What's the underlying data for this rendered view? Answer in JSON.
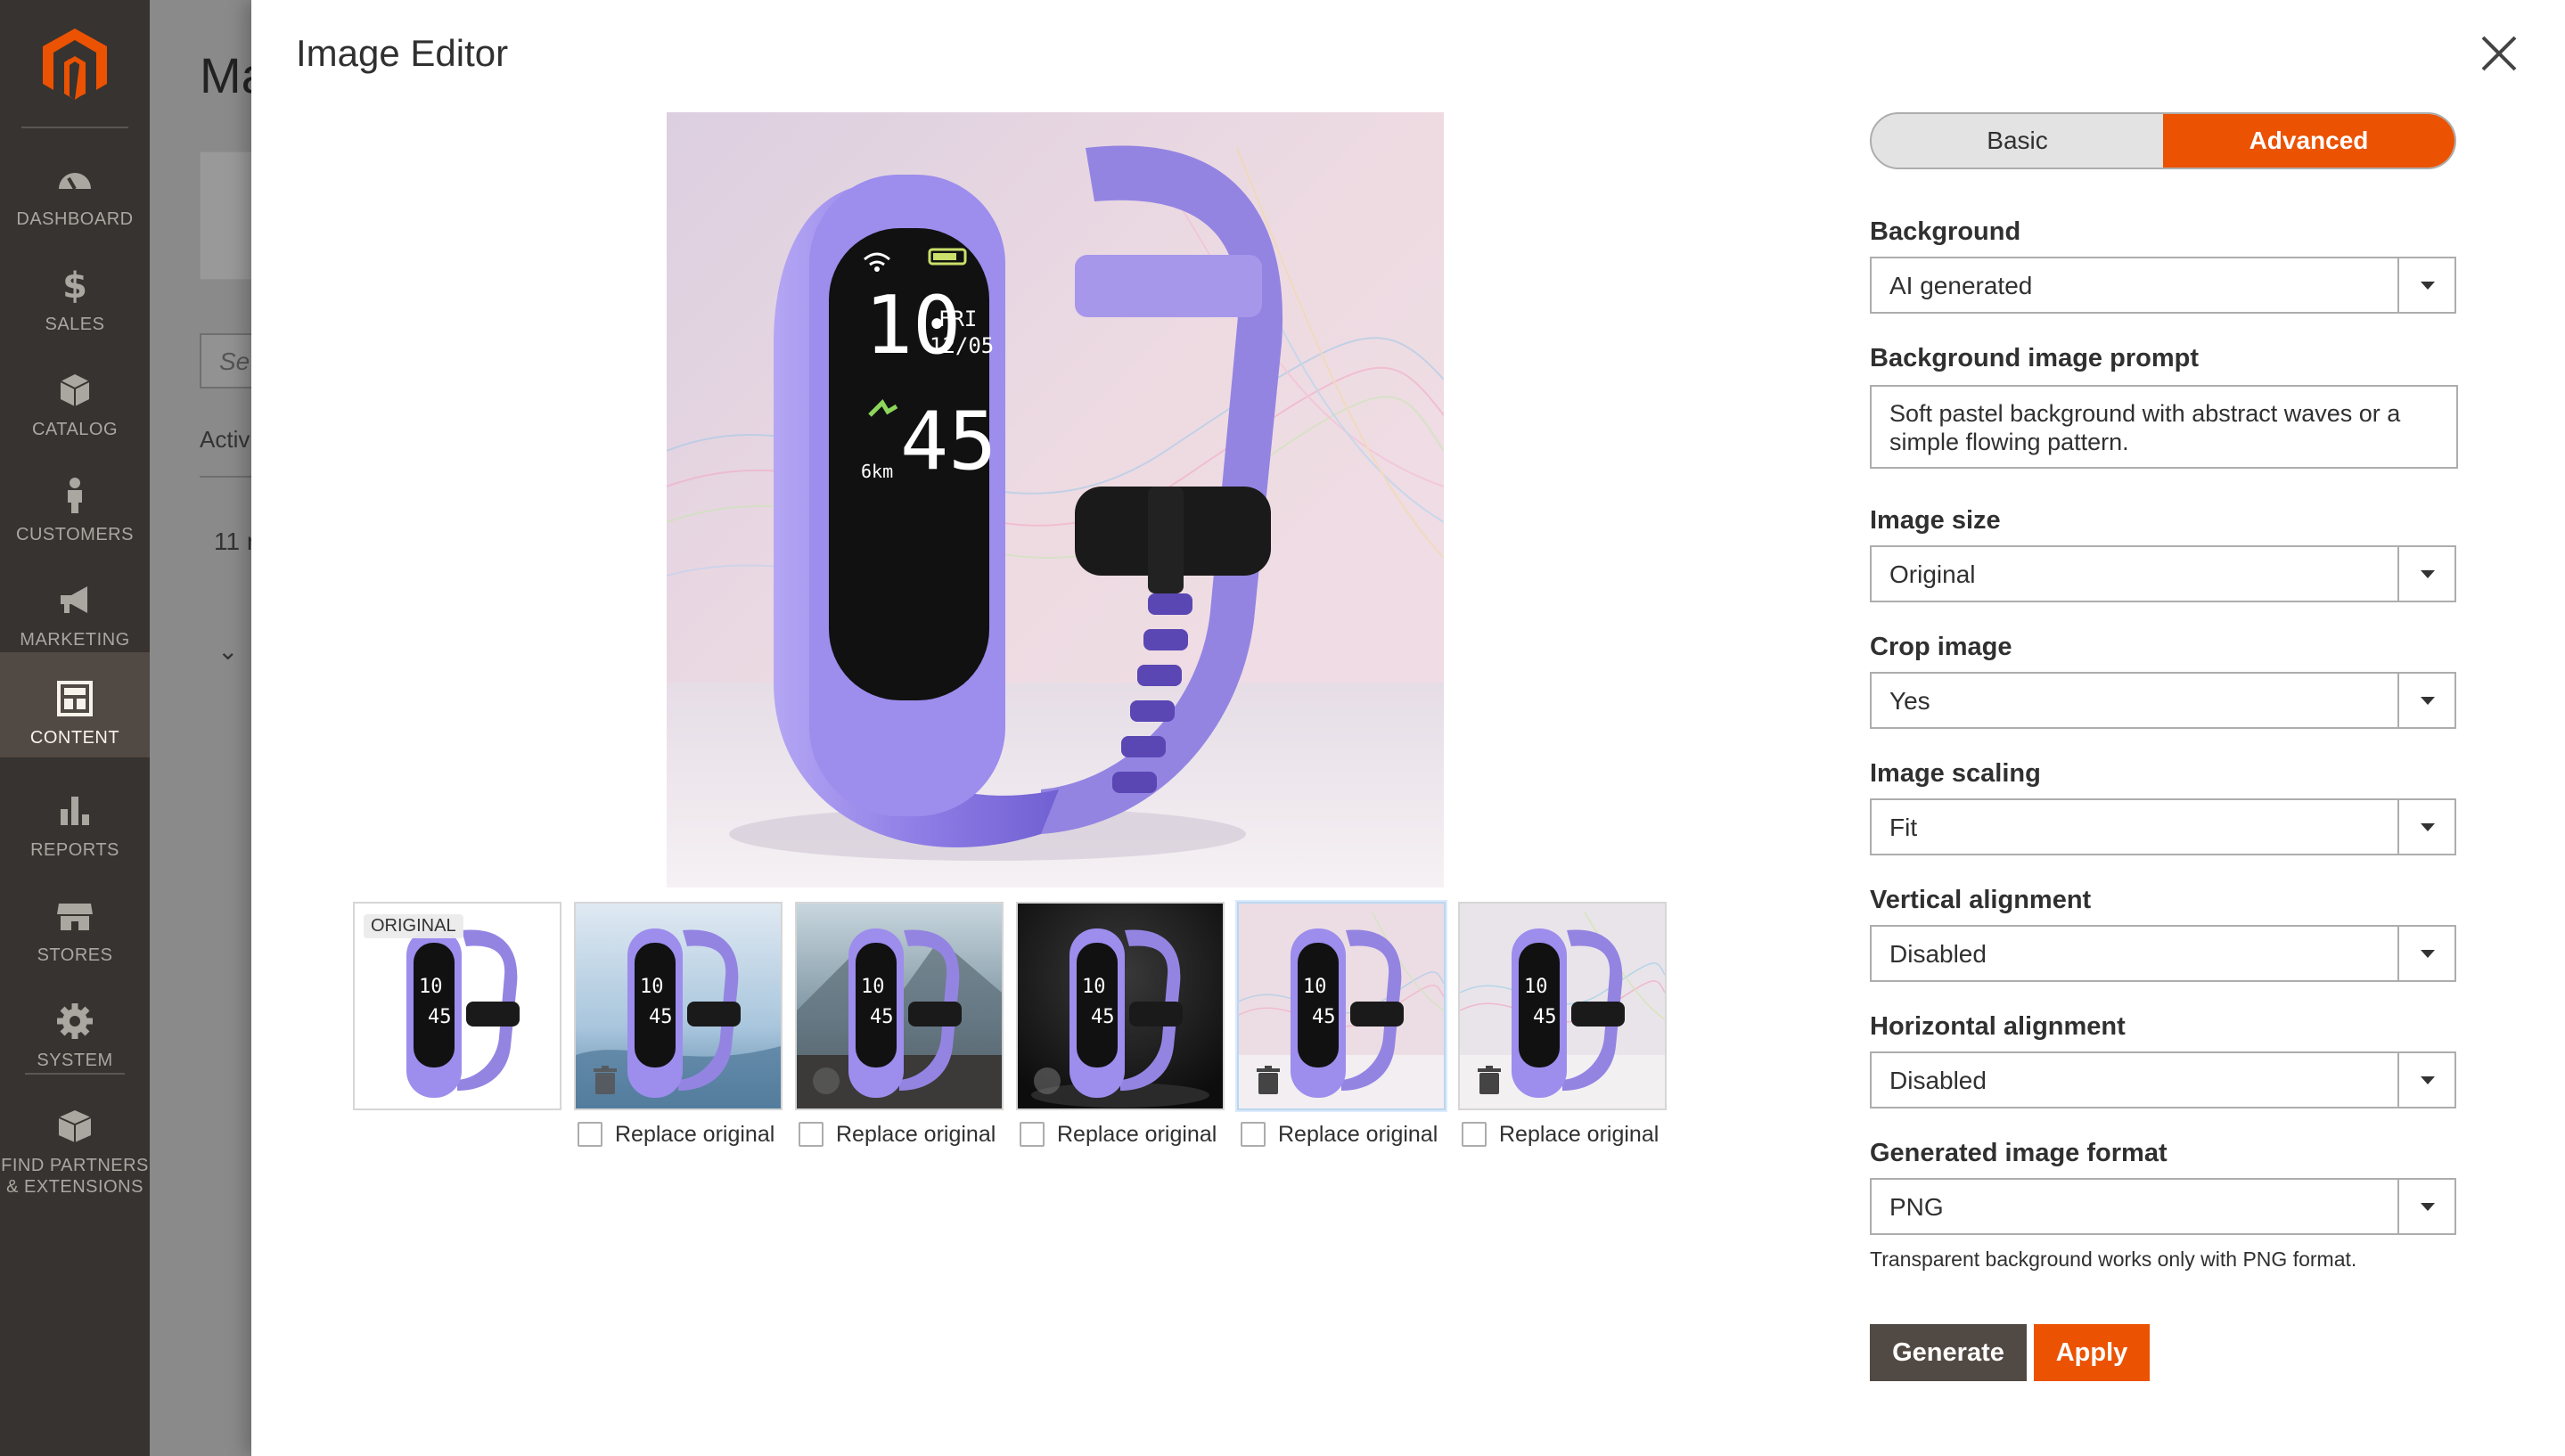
{
  "sidebar": {
    "logo": "magento-logo",
    "items": [
      {
        "label": "DASHBOARD",
        "icon": "dashboard-icon"
      },
      {
        "label": "SALES",
        "icon": "dollar-icon"
      },
      {
        "label": "CATALOG",
        "icon": "box-icon"
      },
      {
        "label": "CUSTOMERS",
        "icon": "person-icon"
      },
      {
        "label": "MARKETING",
        "icon": "megaphone-icon"
      },
      {
        "label": "CONTENT",
        "icon": "content-icon",
        "active": true
      },
      {
        "label": "REPORTS",
        "icon": "bar-chart-icon"
      },
      {
        "label": "STORES",
        "icon": "store-icon"
      },
      {
        "label": "SYSTEM",
        "icon": "gear-icon"
      },
      {
        "label": "FIND PARTNERS",
        "label2": "& EXTENSIONS",
        "icon": "partners-icon"
      }
    ]
  },
  "background_page": {
    "title": "Ma",
    "search_placeholder": "Se",
    "active_text": "Activ",
    "count_text": "11 r"
  },
  "modal": {
    "title": "Image Editor",
    "thumbnails": [
      {
        "badge": "ORIGINAL",
        "bg": "white"
      },
      {
        "replace_label": "Replace original",
        "bg": "water"
      },
      {
        "replace_label": "Replace original",
        "bg": "rocks"
      },
      {
        "replace_label": "Replace original",
        "bg": "dark"
      },
      {
        "replace_label": "Replace original",
        "bg": "pastel",
        "selected": true
      },
      {
        "replace_label": "Replace original",
        "bg": "pastel-light"
      }
    ],
    "mode_toggle": {
      "basic": "Basic",
      "advanced": "Advanced",
      "active": "advanced"
    },
    "fields": {
      "background": {
        "label": "Background",
        "value": "AI generated"
      },
      "background_prompt": {
        "label": "Background image prompt",
        "value": "Soft pastel background with abstract waves or a simple flowing pattern."
      },
      "image_size": {
        "label": "Image size",
        "value": "Original"
      },
      "crop_image": {
        "label": "Crop image",
        "value": "Yes"
      },
      "image_scaling": {
        "label": "Image scaling",
        "value": "Fit"
      },
      "vertical_alignment": {
        "label": "Vertical alignment",
        "value": "Disabled"
      },
      "horizontal_alignment": {
        "label": "Horizontal alignment",
        "value": "Disabled"
      },
      "image_format": {
        "label": "Generated image format",
        "value": "PNG"
      }
    },
    "format_note": "Transparent background works only with PNG format.",
    "buttons": {
      "generate": "Generate",
      "apply": "Apply"
    }
  },
  "watch_display": {
    "hour": "10",
    "day": "FRI",
    "date": "12/05",
    "minute": "45",
    "distance": "6km"
  },
  "colors": {
    "accent": "#eb5202",
    "sidebar": "#373330",
    "button_dark": "#514943",
    "product_purple": "#8f7ee6"
  }
}
